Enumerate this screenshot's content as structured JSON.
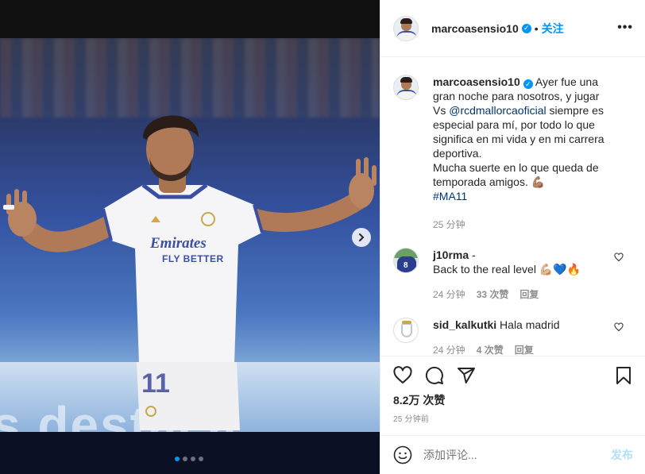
{
  "post": {
    "username": "marcoasensio10",
    "verified": true,
    "follow_label": "关注",
    "more_label": "•••",
    "image": {
      "jersey_sponsor_line1": "Emirates",
      "jersey_sponsor_line2": "FLY BETTER",
      "jersey_number": "11",
      "ad_board_text": "s destaca",
      "carousel_count": 4,
      "carousel_active": 0
    },
    "caption": {
      "username": "marcoasensio10",
      "text_before_mention": "Ayer fue una gran noche para nosotros, y jugar Vs",
      "mention": "@rcdmallorcaoficial",
      "text_after_mention": "siempre es especial para mí, por todo lo que significa en mi vida y en mi carrera deportiva.",
      "line2": "Mucha suerte en lo que queda de temporada amigos. 💪🏽",
      "hashtag": "#MA11",
      "time": "25 分钟"
    },
    "comments": [
      {
        "username": "j10rma",
        "username_suffix": "-",
        "text": "Back to the real level 💪🏼💙🔥",
        "time": "24 分钟",
        "likes": "33 次赞",
        "reply_label": "回复"
      },
      {
        "username": "sid_kalkutki",
        "text": "Hala madrid",
        "time": "24 分钟",
        "likes": "4 次赞",
        "reply_label": "回复"
      }
    ],
    "like_count": "8.2万 次赞",
    "posted_ago": "25 分钟前",
    "add_comment_placeholder": "添加评论...",
    "post_button": "发布",
    "colors": {
      "accent": "#0095f6",
      "muted": "#8e8e8e",
      "post_disabled": "#b2dffc",
      "mention": "#00376b"
    }
  }
}
